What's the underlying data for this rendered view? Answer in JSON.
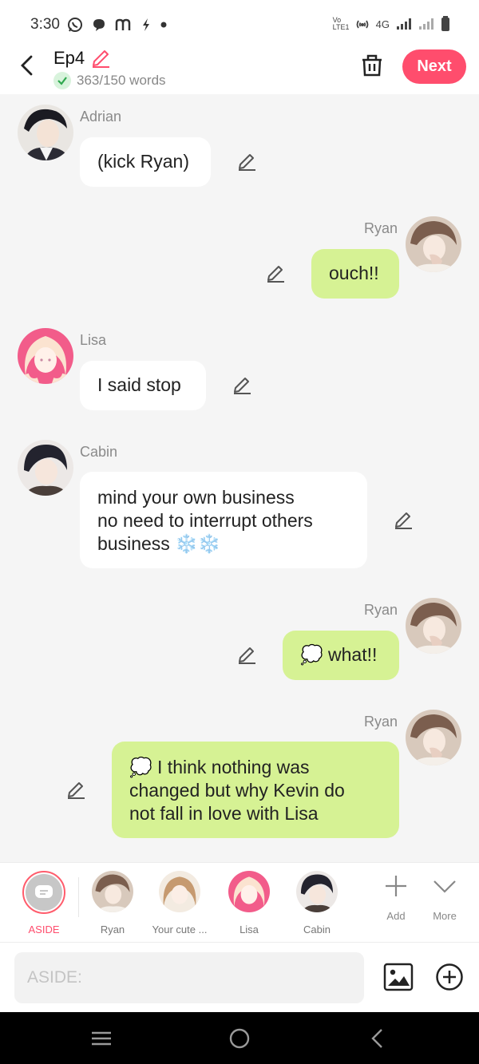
{
  "status": {
    "time": "3:30",
    "left_icons": [
      "whatsapp-icon",
      "chat-bubble-icon",
      "m-icon",
      "bolt-icon",
      "dot-icon"
    ],
    "network": "4G",
    "volte": "Vo LTE1"
  },
  "header": {
    "title": "Ep4",
    "word_count": "363/150 words",
    "next_label": "Next",
    "accent_color": "#ff4d6d"
  },
  "messages": [
    {
      "speaker": "Adrian",
      "text": "(kick Ryan)",
      "side": "left"
    },
    {
      "speaker": "Ryan",
      "text": "ouch!!",
      "side": "right"
    },
    {
      "speaker": "Lisa",
      "text": "I said stop",
      "side": "left"
    },
    {
      "speaker": "Cabin",
      "lines": [
        "mind your own business",
        "no need to interrupt others",
        "business ❄️❄️"
      ],
      "side": "left"
    },
    {
      "speaker": "Ryan",
      "text": "💭 what!!",
      "side": "right"
    },
    {
      "speaker": "Ryan",
      "lines": [
        "💭 I think nothing was",
        "changed but why Kevin do",
        "not fall in love with Lisa"
      ],
      "side": "right"
    }
  ],
  "characters": [
    {
      "label": "ASIDE",
      "selected": true
    },
    {
      "label": "Ryan"
    },
    {
      "label": "Your cute ..."
    },
    {
      "label": "Lisa"
    },
    {
      "label": "Cabin"
    }
  ],
  "tools": {
    "add_label": "Add",
    "more_label": "More"
  },
  "input": {
    "placeholder": "ASIDE:"
  },
  "colors": {
    "right_bubble": "#d6f294",
    "left_bubble": "#ffffff",
    "background": "#f5f5f5"
  }
}
